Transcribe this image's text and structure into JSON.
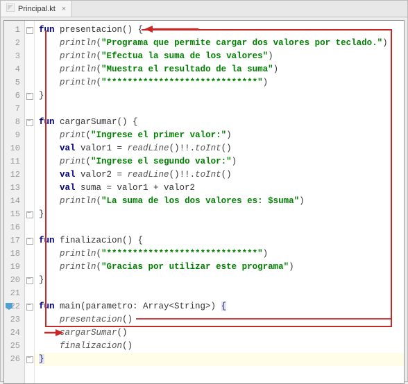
{
  "tab": {
    "filename": "Principal.kt"
  },
  "code": {
    "lines": [
      {
        "n": 1,
        "fold": "open",
        "tokens": [
          [
            "kw",
            "fun "
          ],
          [
            "fn-decl",
            "presentacion"
          ],
          [
            "dot",
            "() {"
          ]
        ]
      },
      {
        "n": 2,
        "fold": "",
        "tokens": [
          [
            "dot",
            "    "
          ],
          [
            "call",
            "println"
          ],
          [
            "dot",
            "("
          ],
          [
            "str",
            "\"Programa que permite cargar dos valores por teclado.\""
          ],
          [
            "dot",
            ")"
          ]
        ]
      },
      {
        "n": 3,
        "fold": "",
        "tokens": [
          [
            "dot",
            "    "
          ],
          [
            "call",
            "println"
          ],
          [
            "dot",
            "("
          ],
          [
            "str",
            "\"Efectua la suma de los valores\""
          ],
          [
            "dot",
            ")"
          ]
        ]
      },
      {
        "n": 4,
        "fold": "",
        "tokens": [
          [
            "dot",
            "    "
          ],
          [
            "call",
            "println"
          ],
          [
            "dot",
            "("
          ],
          [
            "str",
            "\"Muestra el resultado de la suma\""
          ],
          [
            "dot",
            ")"
          ]
        ]
      },
      {
        "n": 5,
        "fold": "",
        "tokens": [
          [
            "dot",
            "    "
          ],
          [
            "call",
            "println"
          ],
          [
            "dot",
            "("
          ],
          [
            "str",
            "\"*****************************\""
          ],
          [
            "dot",
            ")"
          ]
        ]
      },
      {
        "n": 6,
        "fold": "close",
        "tokens": [
          [
            "dot",
            "}"
          ]
        ]
      },
      {
        "n": 7,
        "fold": "",
        "tokens": []
      },
      {
        "n": 8,
        "fold": "open",
        "tokens": [
          [
            "kw",
            "fun "
          ],
          [
            "fn-decl",
            "cargarSumar"
          ],
          [
            "dot",
            "() {"
          ]
        ]
      },
      {
        "n": 9,
        "fold": "",
        "tokens": [
          [
            "dot",
            "    "
          ],
          [
            "call",
            "print"
          ],
          [
            "dot",
            "("
          ],
          [
            "str",
            "\"Ingrese el primer valor:\""
          ],
          [
            "dot",
            ")"
          ]
        ]
      },
      {
        "n": 10,
        "fold": "",
        "tokens": [
          [
            "dot",
            "    "
          ],
          [
            "kw",
            "val "
          ],
          [
            "dot",
            "valor1 = "
          ],
          [
            "call",
            "readLine"
          ],
          [
            "dot",
            "()!!."
          ],
          [
            "call",
            "toInt"
          ],
          [
            "dot",
            "()"
          ]
        ]
      },
      {
        "n": 11,
        "fold": "",
        "tokens": [
          [
            "dot",
            "    "
          ],
          [
            "call",
            "print"
          ],
          [
            "dot",
            "("
          ],
          [
            "str",
            "\"Ingrese el segundo valor:\""
          ],
          [
            "dot",
            ")"
          ]
        ]
      },
      {
        "n": 12,
        "fold": "",
        "tokens": [
          [
            "dot",
            "    "
          ],
          [
            "kw",
            "val "
          ],
          [
            "dot",
            "valor2 = "
          ],
          [
            "call",
            "readLine"
          ],
          [
            "dot",
            "()!!."
          ],
          [
            "call",
            "toInt"
          ],
          [
            "dot",
            "()"
          ]
        ]
      },
      {
        "n": 13,
        "fold": "",
        "tokens": [
          [
            "dot",
            "    "
          ],
          [
            "kw",
            "val "
          ],
          [
            "dot",
            "suma = valor1 + valor2"
          ]
        ]
      },
      {
        "n": 14,
        "fold": "",
        "tokens": [
          [
            "dot",
            "    "
          ],
          [
            "call",
            "println"
          ],
          [
            "dot",
            "("
          ],
          [
            "str",
            "\"La suma de los dos valores es: $suma\""
          ],
          [
            "dot",
            ")"
          ]
        ]
      },
      {
        "n": 15,
        "fold": "close",
        "tokens": [
          [
            "dot",
            "}"
          ]
        ]
      },
      {
        "n": 16,
        "fold": "",
        "tokens": []
      },
      {
        "n": 17,
        "fold": "open",
        "tokens": [
          [
            "kw",
            "fun "
          ],
          [
            "fn-decl",
            "finalizacion"
          ],
          [
            "dot",
            "() {"
          ]
        ]
      },
      {
        "n": 18,
        "fold": "",
        "tokens": [
          [
            "dot",
            "    "
          ],
          [
            "call",
            "println"
          ],
          [
            "dot",
            "("
          ],
          [
            "str",
            "\"*****************************\""
          ],
          [
            "dot",
            ")"
          ]
        ]
      },
      {
        "n": 19,
        "fold": "",
        "tokens": [
          [
            "dot",
            "    "
          ],
          [
            "call",
            "println"
          ],
          [
            "dot",
            "("
          ],
          [
            "str",
            "\"Gracias por utilizar este programa\""
          ],
          [
            "dot",
            ")"
          ]
        ]
      },
      {
        "n": 20,
        "fold": "close",
        "tokens": [
          [
            "dot",
            "}"
          ]
        ]
      },
      {
        "n": 21,
        "fold": "",
        "tokens": []
      },
      {
        "n": 22,
        "fold": "open",
        "mark": true,
        "tokens": [
          [
            "kw",
            "fun "
          ],
          [
            "fn-decl",
            "main"
          ],
          [
            "dot",
            "(parametro: Array<String>) "
          ],
          [
            "dot-hl",
            "{"
          ]
        ]
      },
      {
        "n": 23,
        "fold": "",
        "tokens": [
          [
            "dot",
            "    "
          ],
          [
            "call",
            "presentacion"
          ],
          [
            "dot",
            "()"
          ]
        ]
      },
      {
        "n": 24,
        "fold": "",
        "tokens": [
          [
            "dot",
            "    "
          ],
          [
            "call",
            "cargarSumar"
          ],
          [
            "dot",
            "()"
          ]
        ]
      },
      {
        "n": 25,
        "fold": "",
        "tokens": [
          [
            "dot",
            "    "
          ],
          [
            "call",
            "finalizacion"
          ],
          [
            "dot",
            "()"
          ]
        ]
      },
      {
        "n": 26,
        "fold": "close",
        "hl": true,
        "tokens": [
          [
            "dot-hl",
            "}"
          ]
        ]
      }
    ]
  }
}
